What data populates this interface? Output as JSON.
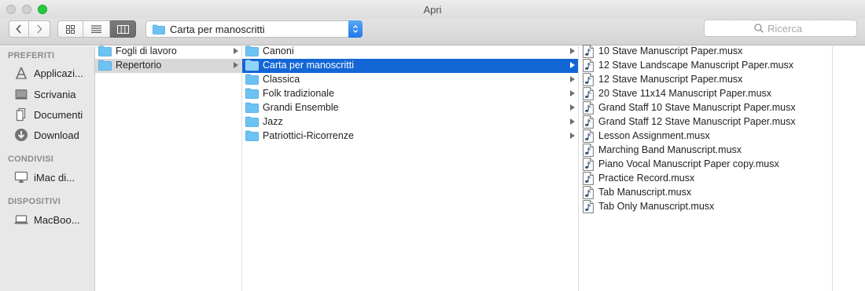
{
  "window": {
    "title": "Apri"
  },
  "toolbar": {
    "path_label": "Carta per manoscritti",
    "search_placeholder": "Ricerca"
  },
  "sidebar": {
    "sections": [
      {
        "heading": "PREFERITI",
        "items": [
          {
            "label": "Applicazi...",
            "icon": "applications-icon"
          },
          {
            "label": "Scrivania",
            "icon": "desktop-icon"
          },
          {
            "label": "Documenti",
            "icon": "documents-icon"
          },
          {
            "label": "Download",
            "icon": "download-icon"
          }
        ]
      },
      {
        "heading": "CONDIVISI",
        "items": [
          {
            "label": "iMac di...",
            "icon": "imac-icon"
          }
        ]
      },
      {
        "heading": "DISPOSITIVI",
        "items": [
          {
            "label": "MacBoo...",
            "icon": "laptop-icon"
          }
        ]
      }
    ]
  },
  "columns": [
    {
      "items": [
        {
          "label": "Fogli di lavoro",
          "type": "folder",
          "selected": ""
        },
        {
          "label": "Repertorio",
          "type": "folder",
          "selected": "gray"
        }
      ]
    },
    {
      "items": [
        {
          "label": "Canoni",
          "type": "folder",
          "selected": ""
        },
        {
          "label": "Carta per manoscritti",
          "type": "folder",
          "selected": "blue"
        },
        {
          "label": "Classica",
          "type": "folder",
          "selected": ""
        },
        {
          "label": "Folk tradizionale",
          "type": "folder",
          "selected": ""
        },
        {
          "label": "Grandi Ensemble",
          "type": "folder",
          "selected": ""
        },
        {
          "label": "Jazz",
          "type": "folder",
          "selected": ""
        },
        {
          "label": "Patriottici-Ricorrenze",
          "type": "folder",
          "selected": ""
        }
      ]
    },
    {
      "items": [
        {
          "label": "10 Stave Manuscript Paper.musx",
          "type": "file"
        },
        {
          "label": "12 Stave Landscape Manuscript Paper.musx",
          "type": "file"
        },
        {
          "label": "12 Stave Manuscript Paper.musx",
          "type": "file"
        },
        {
          "label": "20 Stave 11x14 Manuscript Paper.musx",
          "type": "file"
        },
        {
          "label": "Grand Staff 10 Stave Manuscript Paper.musx",
          "type": "file"
        },
        {
          "label": "Grand Staff 12 Stave Manuscript Paper.musx",
          "type": "file"
        },
        {
          "label": "Lesson Assignment.musx",
          "type": "file"
        },
        {
          "label": "Marching Band Manuscript.musx",
          "type": "file"
        },
        {
          "label": "Piano Vocal  Manuscript Paper copy.musx",
          "type": "file"
        },
        {
          "label": "Practice Record.musx",
          "type": "file"
        },
        {
          "label": "Tab Manuscript.musx",
          "type": "file"
        },
        {
          "label": "Tab Only Manuscript.musx",
          "type": "file"
        }
      ]
    }
  ],
  "colors": {
    "selection_blue": "#1366d6",
    "selection_gray": "#d8d8d8",
    "folder_blue": "#5fb8f0",
    "zoom_green": "#27c93f"
  }
}
